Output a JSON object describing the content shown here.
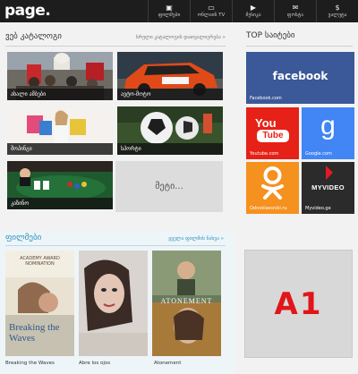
{
  "header": {
    "logo": "page.",
    "nav": [
      {
        "icon": "▣",
        "label": "ფილმები"
      },
      {
        "icon": "▭",
        "label": "ონლაინ TV"
      },
      {
        "icon": "▶",
        "label": "მუსიკა"
      },
      {
        "icon": "✉",
        "label": "ფოსტა"
      },
      {
        "icon": "$",
        "label": "ვალუტა"
      }
    ]
  },
  "catalog": {
    "title": "ვებ კატალოგი",
    "all_link": "სრული კატალოგის დათვალიერება »",
    "tiles": [
      "ახალი ამბები",
      "ავტო-მოტო",
      "შოპინგი",
      "სპორტი",
      "კაზინო"
    ],
    "more": "მეტი..."
  },
  "top_sites": {
    "title": "TOP საიტები",
    "sites": [
      {
        "name": "facebook",
        "label": "Facebook.com",
        "color": "#3b5998"
      },
      {
        "name": "YouTube",
        "label": "Youtube.com",
        "color": "#e62117"
      },
      {
        "name": "g",
        "label": "Google.com",
        "color": "#4285f4"
      },
      {
        "name": "ok",
        "label": "Odnoklassniki.ru",
        "color": "#f5911e"
      },
      {
        "name": "MYVIDEO",
        "label": "Myvideo.ge",
        "color": "#2b2b2b"
      }
    ]
  },
  "films": {
    "title": "ფილმები",
    "all_link": "ყველა ფილმის ნახვა »",
    "items": [
      {
        "title": "Breaking the Waves",
        "poster_top": "ACADEMY AWARD NOMINATION",
        "poster_name": "Breaking the Waves"
      },
      {
        "title": "Abre los ojos",
        "poster_top": "",
        "poster_name": ""
      },
      {
        "title": "Atonement",
        "poster_top": "",
        "poster_name": "ATONEMENT"
      }
    ]
  },
  "ad": {
    "text": "A1"
  }
}
